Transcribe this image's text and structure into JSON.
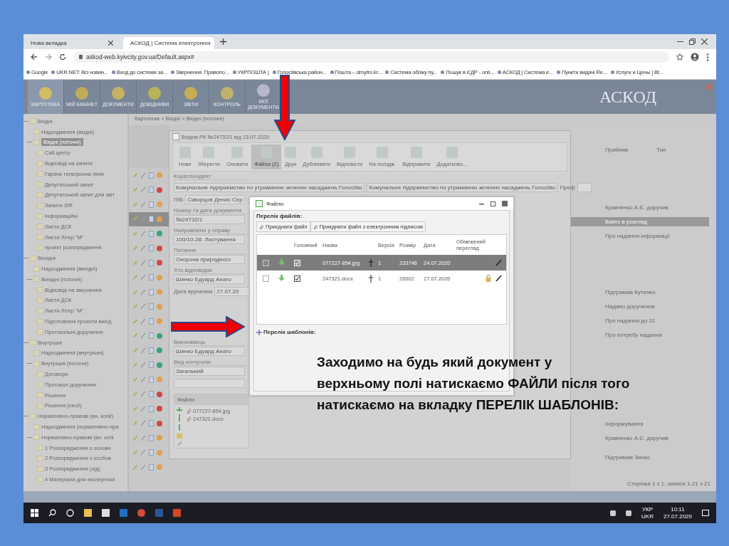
{
  "browser": {
    "tabs": [
      {
        "label": "Нова вкладка",
        "selected": false
      },
      {
        "label": "АСКОД | Система електронног",
        "selected": true
      }
    ],
    "address": "askod-web.kyivcity.gov.ua/Default.aspx#",
    "bookmarks": [
      "Google",
      "UKR.NET: Всі новин...",
      "Вход до системи за...",
      "Звернення. Правопо...",
      "УКРПОШТА |",
      "Голосіївська район...",
      "Пошта – dmytro.kr...",
      "Система обліку пу...",
      "Пошук в ЄДР - onli...",
      "АСКОД | Система е...",
      "Пункти видачі Re...",
      "Услуги и Цены | Bt..."
    ]
  },
  "app": {
    "nav": [
      {
        "label": "КАРТОТЕКА",
        "selected": true
      },
      {
        "label": "МІЙ КАБІНЕТ",
        "selected": false
      },
      {
        "label": "ДОКУМЕНТИ",
        "selected": false
      },
      {
        "label": "ДОВІДНИКИ",
        "selected": false
      },
      {
        "label": "ЗВІТИ",
        "selected": false
      },
      {
        "label": "КОНТРОЛЬ",
        "selected": false
      },
      {
        "label": "МОЇ ДОКУМЕНТИ",
        "selected": false
      }
    ],
    "logo": "АСКОД",
    "breadcrumb": "Картотека > Вхідні > Вхідні (поточні)"
  },
  "tree": [
    {
      "label": "Вхідні",
      "selected": false,
      "expanded": true,
      "children": [
        {
          "label": "Надходження (вхідні)",
          "selected": false
        },
        {
          "label": "Вхідні (поточні)",
          "selected": true,
          "expanded": true,
          "children": [
            {
              "label": "Call-центр",
              "selected": false
            },
            {
              "label": "Відповіді на запити",
              "selected": false
            },
            {
              "label": "Гаряча телефонна лінія",
              "selected": false
            },
            {
              "label": "Депутатський запит",
              "selected": false
            },
            {
              "label": "Депутатський запит для звіт",
              "selected": false
            },
            {
              "label": "Запити ЗІФ",
              "selected": false
            },
            {
              "label": "Інформаційні",
              "selected": false
            },
            {
              "label": "Листи ДСК",
              "selected": false
            },
            {
              "label": "Листи Літер \"М\"",
              "selected": false
            },
            {
              "label": "проект розпорядження",
              "selected": false
            }
          ]
        }
      ]
    },
    {
      "label": "Вихідні",
      "selected": false,
      "expanded": true,
      "children": [
        {
          "label": "Надходження (вихідні)",
          "selected": false
        },
        {
          "label": "Вихідні (поточні)",
          "selected": false,
          "expanded": true,
          "children": [
            {
              "label": "Відповіді на звернення",
              "selected": false
            },
            {
              "label": "Листи ДСК",
              "selected": false
            },
            {
              "label": "Листи Літер \"М\"",
              "selected": false
            },
            {
              "label": "Підготовлені проекти вихід",
              "selected": false
            },
            {
              "label": "Протокольні доручення",
              "selected": false
            }
          ]
        }
      ]
    },
    {
      "label": "Внутрішні",
      "selected": false,
      "expanded": true,
      "children": [
        {
          "label": "Надходження (внутрішні)",
          "selected": false
        },
        {
          "label": "Внутрішні (поточні)",
          "selected": false,
          "expanded": true,
          "children": [
            {
              "label": "Договори",
              "selected": false
            },
            {
              "label": "Протокол доручення",
              "selected": false
            },
            {
              "label": "Рішення",
              "selected": false
            },
            {
              "label": "Рішення (сесії)",
              "selected": false
            }
          ]
        }
      ]
    },
    {
      "label": "Нормативно-правові (вн. копії)",
      "selected": false,
      "expanded": true,
      "children": [
        {
          "label": "Надходження (нормативно-пра",
          "selected": false
        },
        {
          "label": "Нормативно-правові (вн. копі",
          "selected": false,
          "expanded": true,
          "children": [
            {
              "label": "1 Розпорядження з основн",
              "selected": false
            },
            {
              "label": "2 Розпорядження з особов",
              "selected": false
            },
            {
              "label": "3 Розпорядження (з/д)",
              "selected": false
            },
            {
              "label": "4 Матеріали для експертизи",
              "selected": false
            }
          ]
        }
      ]
    }
  ],
  "list_rows": [
    {
      "color": "#e0a050",
      "selected": false
    },
    {
      "color": "#d04848",
      "selected": false
    },
    {
      "color": "#e0a050",
      "selected": false
    },
    {
      "color": "#e0a050",
      "selected": true
    },
    {
      "color": "#3aa37a",
      "selected": false
    },
    {
      "color": "#d04848",
      "selected": false
    },
    {
      "color": "#d04848",
      "selected": false
    },
    {
      "color": "#e0a050",
      "selected": false
    },
    {
      "color": "#e0a050",
      "selected": false
    },
    {
      "color": "#e0a050",
      "selected": false
    },
    {
      "color": "#e0a050",
      "selected": false
    },
    {
      "color": "#3aa37a",
      "selected": false
    },
    {
      "color": "#3aa37a",
      "selected": false
    },
    {
      "color": "#3aa37a",
      "selected": false
    },
    {
      "color": "#e0a050",
      "selected": false
    },
    {
      "color": "#d04848",
      "selected": false
    },
    {
      "color": "#d04848",
      "selected": false
    },
    {
      "color": "#d04848",
      "selected": false
    },
    {
      "color": "#e0a050",
      "selected": false
    },
    {
      "color": "#e0a050",
      "selected": false
    },
    {
      "color": "#e0a050",
      "selected": false
    }
  ],
  "right_panel": {
    "columns": [
      "Прийняв",
      "Тип"
    ],
    "groups": [
      [
        {
          "text": "Кравченко А.Є. доручив",
          "selected": false
        },
        {
          "text": "Взято в розгляд",
          "selected": true
        },
        {
          "text": "Про надання інформації",
          "selected": false
        }
      ],
      [
        {
          "text": "Підтримав Кутенко",
          "selected": false
        },
        {
          "text": "Надано доручення",
          "selected": false
        },
        {
          "text": "Про надання до 31",
          "selected": false
        },
        {
          "text": "Про потребу надання",
          "selected": false
        }
      ],
      [
        {
          "text": "Інформування",
          "selected": false
        },
        {
          "text": "Кравченко А.Є. доручив",
          "selected": false
        }
      ],
      [
        {
          "text": "Підтримав Зинко",
          "selected": false
        }
      ]
    ],
    "pager": "Сторінка 1 з 1, записи 1-21 з 21"
  },
  "document": {
    "title": "Вхідна РК №24732/1 від 23.07.2020",
    "toolbar": [
      {
        "label": "Нове",
        "selected": false
      },
      {
        "label": "Зберегти",
        "selected": false
      },
      {
        "label": "Оновити",
        "selected": false
      },
      {
        "label": "Файли (2)",
        "selected": true
      },
      {
        "label": "Друк",
        "selected": false
      },
      {
        "label": "Дублювати",
        "selected": false
      },
      {
        "label": "Відповісти",
        "selected": false
      },
      {
        "label": "На погодж.",
        "selected": false
      },
      {
        "label": "Відправити",
        "selected": false
      },
      {
        "label": "Додатково...",
        "selected": false
      }
    ],
    "correspondent": {
      "legend": "Кореспондент",
      "value": "Комунальне підприємство по утриманню зелених насаджень Голосіївс",
      "value2": "Комунальне підприємство по утриманню зелених насаджень Голосіївс",
      "pref": "Преф"
    },
    "fields": [
      {
        "kind": "prefixed",
        "prefix": "ПІБ",
        "value": "Скворцов Денис Сер"
      },
      {
        "kind": "legend",
        "legend": "Номер та дата документа",
        "value": "№24732/1"
      },
      {
        "kind": "legend",
        "legend": "Направлено у справу",
        "value": "100/10-28: Листування"
      },
      {
        "kind": "legend",
        "legend": "Питання",
        "value": "Охорона природного"
      },
      {
        "kind": "legend",
        "legend": "Хто відповідає",
        "value": "Шинко Едуард Анато"
      },
      {
        "kind": "prefixed",
        "prefix": "Дата вручення",
        "value": "27.07.20"
      },
      {
        "kind": "legend",
        "legend": "Виконавець",
        "value": "Шинко Едуард Анато"
      },
      {
        "kind": "legend",
        "legend": "Вид контролю",
        "value": "Загальний"
      }
    ],
    "files_panel": {
      "title": "Файли",
      "files": [
        "077227-854.jpg",
        "247321.docx"
      ]
    }
  },
  "dialog": {
    "title": "Файли",
    "section": "Перелік файлів:",
    "buttons": [
      "Приєднати файл",
      "Приєднати файл з електронним підписом"
    ],
    "columns": [
      "Головний",
      "Назва",
      "Версія",
      "Розмір",
      "Дата",
      "Обмежений перегляд"
    ],
    "rows": [
      {
        "selected": true,
        "checked": false,
        "main": true,
        "name": "077227-854.jpg",
        "version": "1",
        "size": "233746",
        "date": "24.07.2020",
        "restricted": false
      },
      {
        "selected": false,
        "checked": false,
        "main": true,
        "name": "247321.docx",
        "version": "1",
        "size": "20002",
        "date": "27.07.2020",
        "restricted": true
      }
    ],
    "templates": {
      "label": "Перелік шаблонів:",
      "expanded": false
    }
  },
  "caption": "Заходимо на будь який документ у\nверхньому полі натискаємо ФАЙЛИ після того\nнатискаємо на вкладку ПЕРЕЛІК ШАБЛОНІВ:",
  "taskbar": {
    "lang": "УКР",
    "lang2": "UKR",
    "time": "10:11",
    "date": "27.07.2020"
  }
}
